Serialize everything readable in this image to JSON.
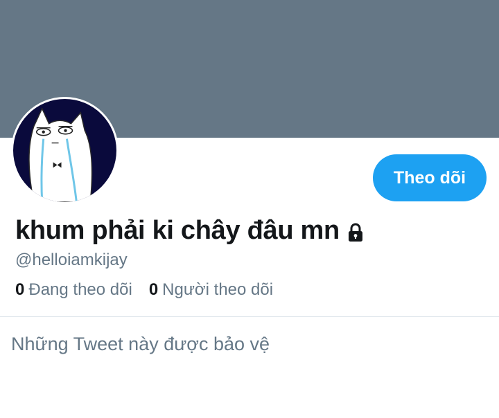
{
  "profile": {
    "display_name": "khum phải ki chây đâu mn",
    "handle": "@helloiamkijay",
    "protected": true
  },
  "actions": {
    "follow_label": "Theo dõi"
  },
  "stats": {
    "following_count": "0",
    "following_label": "Đang theo dõi",
    "followers_count": "0",
    "followers_label": "Người theo dõi"
  },
  "timeline": {
    "protected_message": "Những Tweet này được bảo vệ"
  },
  "colors": {
    "banner": "#657786",
    "accent": "#1da1f2",
    "text_primary": "#14171a",
    "text_secondary": "#657786"
  },
  "icons": {
    "lock": "lock-icon",
    "avatar": "avatar-image"
  }
}
